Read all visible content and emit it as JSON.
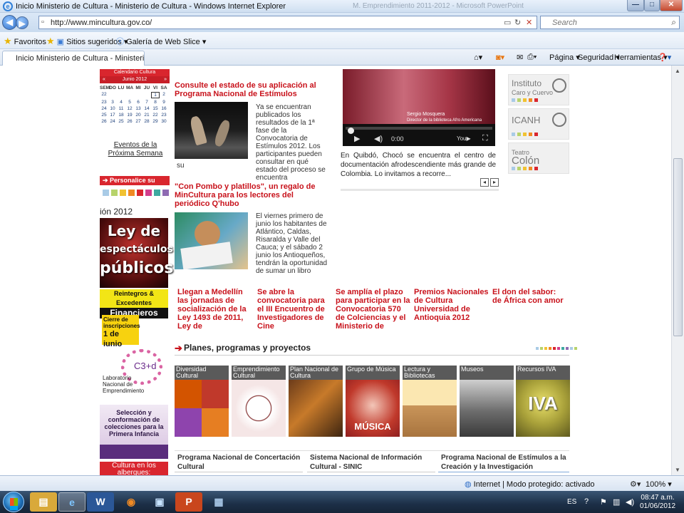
{
  "window": {
    "title": "Inicio Ministerio de Cultura - Ministerio de Cultura - Windows Internet Explorer",
    "ghost_title": "M. Emprendimiento 2011-2012 - Microsoft PowerPoint",
    "minimize": "—",
    "maximize": "□",
    "close": "✕"
  },
  "address": {
    "url": "http://www.mincultura.gov.co/",
    "search_placeholder": "Search"
  },
  "favorites": {
    "favorites_label": "Favoritos",
    "suggested_label": "Sitios sugeridos ▾",
    "webslice_label": "Galería de Web Slice ▾"
  },
  "tab": {
    "title": "Inicio Ministerio de Cultura - Ministerio de Cultura"
  },
  "commands": {
    "page": "Página ▾",
    "safety": "Seguridad ▾",
    "tools": "Herramientas ▾"
  },
  "calendar": {
    "header": "Calendario Cultura",
    "month": "Junio 2012",
    "prev": "«",
    "next": "»",
    "days": [
      "SEM",
      "DO",
      "LU",
      "MA",
      "MI",
      "JU",
      "VI",
      "SA"
    ],
    "rows": [
      [
        "22",
        "",
        "",
        "",
        "",
        "",
        "1",
        "2"
      ],
      [
        "23",
        "3",
        "4",
        "5",
        "6",
        "7",
        "8",
        "9"
      ],
      [
        "24",
        "10",
        "11",
        "12",
        "13",
        "14",
        "15",
        "16"
      ],
      [
        "25",
        "17",
        "18",
        "19",
        "20",
        "21",
        "22",
        "23"
      ],
      [
        "26",
        "24",
        "25",
        "26",
        "27",
        "28",
        "29",
        "30"
      ]
    ],
    "events_link": "Eventos de la Próxima Semana"
  },
  "left": {
    "personalize": "➔ Personalice su Color",
    "year_label": "ión 2012",
    "ley_line1": "Ley de",
    "ley_line2": "espectáculos",
    "ley_line3": "públicos",
    "reintegros_line1": "Reintegros & Excedentes",
    "reintegros_line2": "Financieros",
    "cierre_line1": "Cierre de",
    "cierre_line2": "inscripciones",
    "cierre_line3": "1 de junio",
    "lab_logo": "C3+d",
    "lab_text": "Laboratorio Nacional de Emprendimiento",
    "seleccion_text": "Selección y conformación de colecciones para la Primera Infancia",
    "cultura_text": "Cultura en los albergues:"
  },
  "news": [
    {
      "title": "Consulte el estado de su aplicación al Programa Nacional de Estímulos",
      "body": "Ya se encuentran publicados los resultados de la 1ª fase de la Convocatoria de Estímulos 2012. Los participantes pueden consultar en qué estado del proceso se encuentra",
      "tail": "su"
    },
    {
      "title": "\"Con Pombo y platillos\", un regalo de MinCultura para los lectores del periódico Q'hubo",
      "body": "El viernes primero de junio los habitantes de Atlántico, Caldas, Risaralda y Valle del Cauca; y el sábado 2 junio los Antioqueños, tendrán la oportunidad de sumar un libro"
    }
  ],
  "video": {
    "caption_name": "Sergio Mosquera",
    "caption_sub": "Director de la biblioteca Afro Americana",
    "time": "0:00",
    "text": "En Quibdó, Chocó se encuentra el centro de documentación afrodescendiente más grande de Colombia. Lo invitamos a recorre...",
    "prev": "◂",
    "next": "▸"
  },
  "logos": [
    {
      "line1": "Instituto",
      "line2": "Caro y Cuervo"
    },
    {
      "line1": "ICANH",
      "line2": ""
    },
    {
      "line1": "Teatro",
      "line2": "Colón"
    }
  ],
  "row_news": [
    "Llegan a Medellín las jornadas de socialización de la Ley 1493 de 2011, Ley de",
    "Se abre la convocatoria para el III Encuentro de Investigadores de Cine",
    "Se amplía el plazo para participar en la Convocatoria 570 de Colciencias y el Ministerio de",
    "Premios Nacionales de Cultura Universidad de Antioquia 2012",
    "El don del sabor: de África con amor"
  ],
  "planes": {
    "arrow": "➔",
    "title": "Planes, programas y proyectos",
    "tiles": [
      "Diversidad Cultural",
      "Emprendimiento Cultural",
      "Plan Nacional de Cultura",
      "Grupo de Música",
      "Lectura y Bibliotecas",
      "Museos",
      "Recursos IVA"
    ],
    "musica_word": "MÚSICA",
    "iva_word": "IVA"
  },
  "programs": [
    "Programa Nacional de Concertación Cultural",
    "Sistema Nacional de Información Cultural - SINIC",
    "Programa Nacional de Estímulos a la Creación y la Investigación"
  ],
  "status": {
    "zone": "Internet | Modo protegido: activado",
    "zoom": "100%  ▾"
  },
  "taskbar": {
    "lang": "ES",
    "time": "08:47 a.m.",
    "date": "01/06/2012",
    "word_label": "W",
    "ppt_label": "P"
  },
  "colors": {
    "accent_red": "#c8121b",
    "swatches": [
      "#a9cbe6",
      "#b7d36b",
      "#f1c232",
      "#f08a24",
      "#d9262e",
      "#d23e8d",
      "#3fa9a0",
      "#8e6bb3"
    ]
  }
}
